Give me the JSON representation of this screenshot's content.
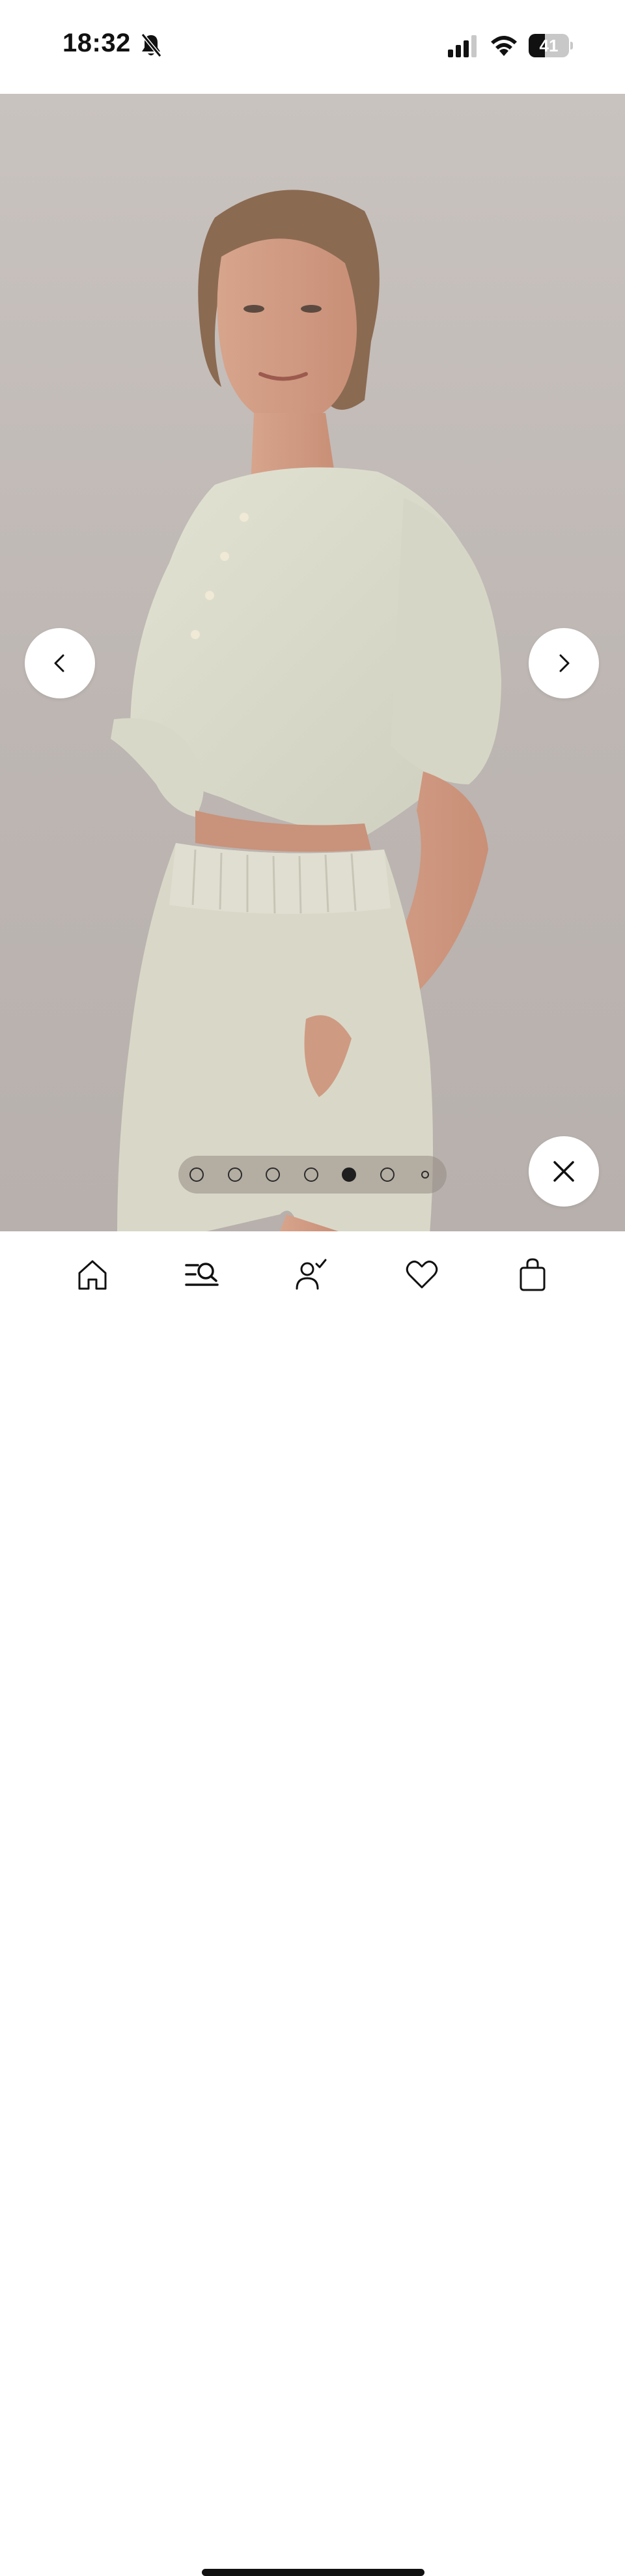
{
  "status_bar": {
    "time": "18:32",
    "battery_percent": "41",
    "battery_level": 0.41,
    "icons": [
      "bell-slash-icon",
      "signal-icon",
      "wifi-icon",
      "battery-icon"
    ]
  },
  "gallery": {
    "image_count": 7,
    "active_index": 4,
    "colors": {
      "backdrop": "#c4beba",
      "garment": "#dcdccc",
      "pager_bg": "#968a84"
    },
    "buttons": {
      "previous": "chevron-left-icon",
      "next": "chevron-right-icon",
      "close": "close-icon"
    }
  },
  "tab_bar": {
    "items": [
      {
        "name": "home",
        "icon": "home-icon"
      },
      {
        "name": "search",
        "icon": "search-icon"
      },
      {
        "name": "account",
        "icon": "account-icon"
      },
      {
        "name": "wishlist",
        "icon": "heart-icon"
      },
      {
        "name": "bag",
        "icon": "bag-icon"
      }
    ]
  }
}
